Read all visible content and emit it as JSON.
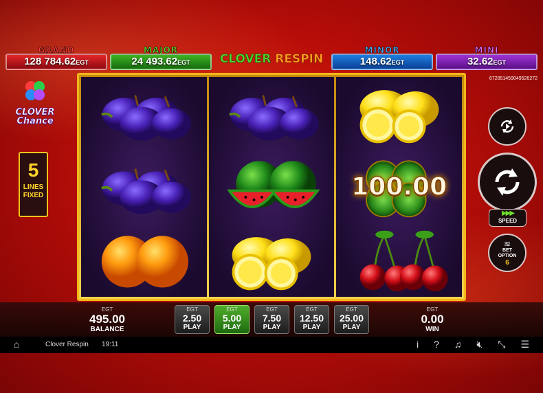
{
  "jackpots": {
    "grand": {
      "title": "GRAND",
      "amount": "128 784.62",
      "currency": "EGT"
    },
    "major": {
      "title": "MAJOR",
      "amount": "24 493.62",
      "currency": "EGT"
    },
    "minor": {
      "title": "MINOR",
      "amount": "148.62",
      "currency": "EGT"
    },
    "mini": {
      "title": "MINI",
      "amount": "32.62",
      "currency": "EGT"
    }
  },
  "logo": {
    "word1": "CLOVER",
    "word2": "RESPIN"
  },
  "side_logo": {
    "line1": "CLOVER",
    "line2": "Chance"
  },
  "ticket_id": "672851459049526272",
  "lines": {
    "count": "5",
    "line1": "LINES",
    "line2": "FIXED"
  },
  "reels": [
    [
      "plum",
      "plum",
      "orange"
    ],
    [
      "plum",
      "watermelon",
      "lemon"
    ],
    [
      "lemon",
      "clover",
      "cherry"
    ]
  ],
  "clover_prize": "100.00",
  "controls": {
    "speed_label": "SPEED",
    "bet_option_label1": "BET",
    "bet_option_label2": "OPTION",
    "bet_option_value": "6"
  },
  "balance": {
    "currency": "EGT",
    "value": "495.00",
    "label": "BALANCE"
  },
  "win": {
    "currency": "EGT",
    "value": "0.00",
    "label": "WIN"
  },
  "bets": [
    {
      "currency": "EGT",
      "amount": "2.50",
      "label": "PLAY",
      "active": false
    },
    {
      "currency": "EGT",
      "amount": "5.00",
      "label": "PLAY",
      "active": true
    },
    {
      "currency": "EGT",
      "amount": "7.50",
      "label": "PLAY",
      "active": false
    },
    {
      "currency": "EGT",
      "amount": "12.50",
      "label": "PLAY",
      "active": false
    },
    {
      "currency": "EGT",
      "amount": "25.00",
      "label": "PLAY",
      "active": false
    }
  ],
  "system_bar": {
    "game_name": "Clover Respin",
    "time": "19:11",
    "icons": [
      "home-icon",
      "info-icon",
      "help-icon",
      "music-off-icon",
      "sound-off-icon",
      "fullscreen-exit-icon",
      "menu-icon"
    ]
  },
  "colors": {
    "accent_gold": "#f2b81c",
    "active_bet": "#4fae2a"
  }
}
